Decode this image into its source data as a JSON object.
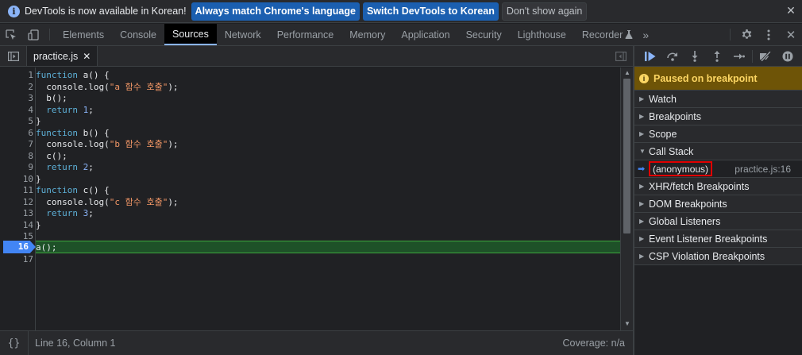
{
  "infobar": {
    "message": "DevTools is now available in Korean!",
    "btn_match": "Always match Chrome's language",
    "btn_switch": "Switch DevTools to Korean",
    "btn_dismiss": "Don't show again"
  },
  "tabs": [
    "Elements",
    "Console",
    "Sources",
    "Network",
    "Performance",
    "Memory",
    "Application",
    "Security",
    "Lighthouse",
    "Recorder"
  ],
  "active_tab": "Sources",
  "file_tab": "practice.js",
  "code_lines": [
    "function a() {",
    "  console.log(\"a 함수 호출\");",
    "  b();",
    "  return 1;",
    "}",
    "function b() {",
    "  console.log(\"b 함수 호출\");",
    "  c();",
    "  return 2;",
    "}",
    "function c() {",
    "  console.log(\"c 함수 호출\");",
    "  return 3;",
    "}",
    "",
    "a();",
    ""
  ],
  "current_line": 16,
  "status": {
    "position": "Line 16, Column 1",
    "coverage": "Coverage: n/a",
    "pretty_print": "{}"
  },
  "debugger": {
    "paused_text": "Paused on breakpoint",
    "sections_before": [
      "Watch",
      "Breakpoints",
      "Scope"
    ],
    "call_stack_label": "Call Stack",
    "frame": {
      "name": "(anonymous)",
      "location": "practice.js:16"
    },
    "sections_after": [
      "XHR/fetch Breakpoints",
      "DOM Breakpoints",
      "Global Listeners",
      "Event Listener Breakpoints",
      "CSP Violation Breakpoints"
    ]
  },
  "colors": {
    "accent_blue": "#8ab4f8",
    "paused_bg": "#6e5407",
    "exec_line_bg": "#1e5128",
    "breakpoint_marker": "#4285f4",
    "highlight_box": "#e00000"
  }
}
